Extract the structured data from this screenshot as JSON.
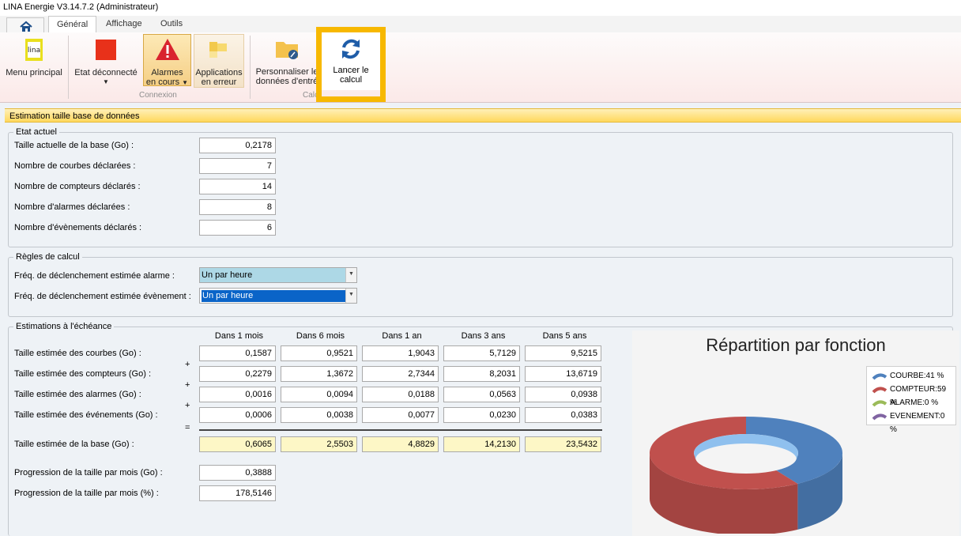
{
  "window": {
    "title": "LINA Energie  V3.14.7.2  (Administrateur)"
  },
  "tabs": [
    "Général",
    "Affichage",
    "Outils"
  ],
  "ribbon": {
    "menu": "Menu principal",
    "etat": "Etat déconnecté",
    "alarmes": [
      "Alarmes",
      "en cours"
    ],
    "apps": [
      "Applications",
      "en erreur"
    ],
    "perso": [
      "Personnaliser le",
      "données d'entré"
    ],
    "lancer": [
      "Lancer le",
      "calcul"
    ],
    "group_connexion": "Connexion",
    "group_calcul": "Calc"
  },
  "panel": {
    "title": "Estimation taille base de données"
  },
  "etat_actuel": {
    "legend": "Etat actuel",
    "rows": [
      {
        "label": "Taille actuelle de la base (Go) :",
        "value": "0,2178"
      },
      {
        "label": "Nombre de courbes déclarées :",
        "value": "7"
      },
      {
        "label": "Nombre de compteurs déclarés :",
        "value": "14"
      },
      {
        "label": "Nombre d'alarmes déclarées :",
        "value": "8"
      },
      {
        "label": "Nombre d'évènements déclarés :",
        "value": "6"
      }
    ]
  },
  "regles": {
    "legend": "Règles de calcul",
    "alarme_label": "Fréq. de déclenchement estimée alarme :",
    "alarme_value": "Un par heure",
    "evenement_label": "Fréq. de déclenchement estimée évènement :",
    "evenement_value": "Un par heure"
  },
  "estimations": {
    "legend": "Estimations à l'échéance",
    "columns": [
      "Dans 1 mois",
      "Dans 6 mois",
      "Dans 1 an",
      "Dans 3 ans",
      "Dans 5 ans"
    ],
    "rows": [
      {
        "label": "Taille estimée des courbes (Go) :",
        "values": [
          "0,1587",
          "0,9521",
          "1,9043",
          "5,7129",
          "9,5215"
        ]
      },
      {
        "label": "Taille estimée des compteurs (Go) :",
        "values": [
          "0,2279",
          "1,3672",
          "2,7344",
          "8,2031",
          "13,6719"
        ]
      },
      {
        "label": "Taille estimée des alarmes (Go) :",
        "values": [
          "0,0016",
          "0,0094",
          "0,0188",
          "0,0563",
          "0,0938"
        ]
      },
      {
        "label": "Taille estimée des événements (Go) :",
        "values": [
          "0,0006",
          "0,0038",
          "0,0077",
          "0,0230",
          "0,0383"
        ]
      }
    ],
    "plus": "+",
    "equals": "=",
    "total": {
      "label": "Taille estimée de la base (Go) :",
      "values": [
        "0,6065",
        "2,5503",
        "4,8829",
        "14,2130",
        "23,5432"
      ]
    },
    "progression_go": {
      "label": "Progression de la taille par mois (Go) :",
      "value": "0,3888"
    },
    "progression_pct": {
      "label": "Progression de la taille par mois (%) :",
      "value": "178,5146"
    }
  },
  "chart_data": {
    "type": "pie",
    "title": "Répartition par fonction",
    "categories": [
      "COURBE",
      "COMPTEUR",
      "ALARME",
      "EVENEMENT"
    ],
    "values": [
      41,
      59,
      0,
      0
    ],
    "legend_labels": [
      "COURBE:41 %",
      "COMPTEUR:59 %",
      "ALARME:0 %",
      "EVENEMENT:0 %"
    ],
    "colors": [
      "#4f81bd",
      "#c0504d",
      "#9bbb59",
      "#8064a2"
    ],
    "legend": "right"
  }
}
